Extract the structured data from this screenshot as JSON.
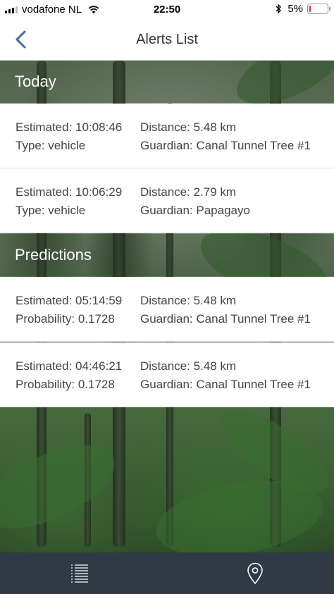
{
  "status_bar": {
    "carrier": "vodafone NL",
    "time": "22:50",
    "battery": "5%",
    "battery_level": 0.05
  },
  "nav": {
    "title": "Alerts List",
    "back_icon": "chevron-left-icon"
  },
  "sections": {
    "today": {
      "title": "Today",
      "alerts": [
        {
          "estimated": "Estimated: 10:08:46",
          "type": "Type: vehicle",
          "distance": "Distance: 5.48 km",
          "guardian": "Guardian: Canal Tunnel Tree #1"
        },
        {
          "estimated": "Estimated: 10:06:29",
          "type": "Type: vehicle",
          "distance": "Distance: 2.79 km",
          "guardian": "Guardian: Papagayo"
        }
      ]
    },
    "predictions": {
      "title": "Predictions",
      "alerts": [
        {
          "estimated": "Estimated: 05:14:59",
          "probability": "Probability: 0.1728",
          "distance": "Distance: 5.48 km",
          "guardian": "Guardian: Canal Tunnel Tree #1"
        },
        {
          "estimated": "Estimated: 04:46:21",
          "probability": "Probability: 0.1728",
          "distance": "Distance: 5.48 km",
          "guardian": "Guardian: Canal Tunnel Tree #1"
        }
      ]
    }
  },
  "tab_bar": {
    "tabs": [
      {
        "icon": "list-icon"
      },
      {
        "icon": "map-pin-icon"
      }
    ]
  },
  "colors": {
    "accent": "#3a6fa8",
    "tab_bar_bg": "#2f3a44",
    "battery_low": "#e0312b"
  }
}
